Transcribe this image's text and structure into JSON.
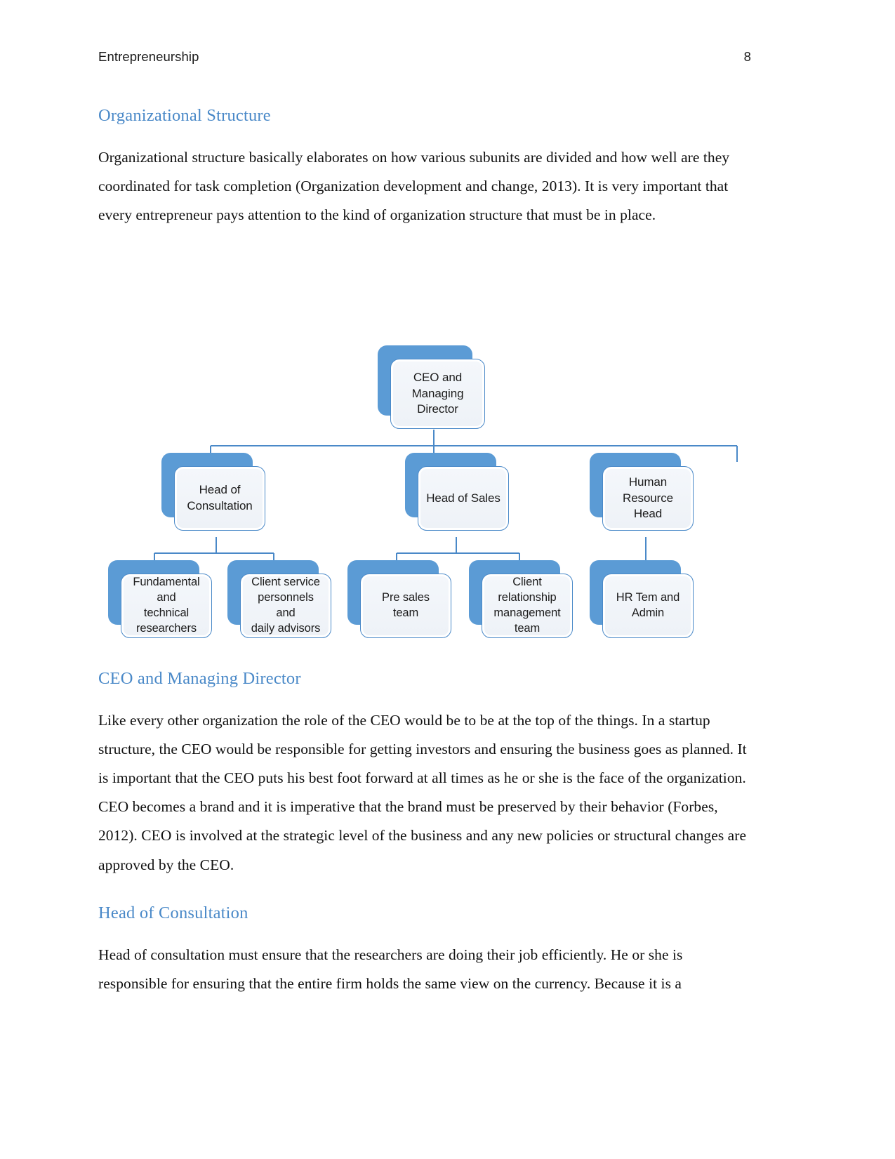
{
  "header": {
    "title": "Entrepreneurship",
    "page_number": "8"
  },
  "sections": [
    {
      "heading": "Organizational Structure",
      "paragraph": "Organizational structure basically elaborates on how various subunits are divided and how well are they coordinated for task completion (Organization development and change, 2013). It is very important that every entrepreneur pays attention to the kind of organization structure that must be in place."
    },
    {
      "heading": "CEO and Managing Director",
      "paragraph": "Like every other organization the role of the CEO would be to be at the top of the things. In a startup structure, the CEO would be responsible for getting investors and ensuring the business goes as planned. It is important that the CEO puts his best foot forward at all times as he or she is the face of the organization. CEO becomes a brand and it is imperative that the brand must be preserved by their behavior (Forbes, 2012). CEO is involved at the strategic level of the business and any new policies or structural changes are approved by the CEO."
    },
    {
      "heading": "Head of Consultation",
      "paragraph": "Head of consultation must ensure that the researchers are doing their job efficiently. He or she is responsible for ensuring that the entire firm holds the same view on the currency. Because it is a"
    }
  ],
  "org_chart": {
    "type": "diagram",
    "style": "smartart-hierarchy",
    "colors": {
      "shadow_block": "#5b9bd5",
      "card_border": "#4a89c8",
      "card_fill": "#ffffff",
      "inner_panel": "#f0f4f9",
      "connector": "#4a89c8",
      "label_text": "#1c1c1c"
    },
    "nodes": {
      "root": {
        "label": "CEO and Managing\nDirector"
      },
      "level2": [
        {
          "label": "Head of\nConsultation"
        },
        {
          "label": "Head of Sales"
        },
        {
          "label": "Human Resource\nHead"
        }
      ],
      "level3": [
        {
          "label": "Fundamental and\ntechnical\nresearchers",
          "parent": "Head of Consultation"
        },
        {
          "label": "Client service\npersonnels and\ndaily advisors",
          "parent": "Head of Consultation"
        },
        {
          "label": "Pre sales team",
          "parent": "Head of Sales"
        },
        {
          "label": "Client relationship\nmanagement team",
          "parent": "Head of Sales"
        },
        {
          "label": "HR Tem and Admin",
          "parent": "Human Resource Head"
        }
      ]
    }
  }
}
